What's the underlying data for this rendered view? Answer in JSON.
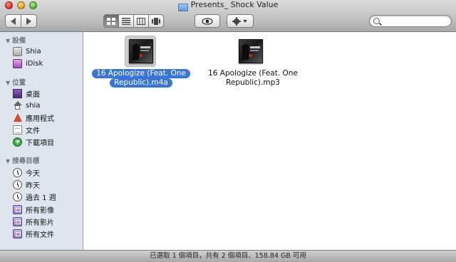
{
  "window": {
    "title": "Presents_ Shock Value",
    "folder_icon": "folder-icon"
  },
  "toolbar": {
    "back_icon": "back-arrow-icon",
    "forward_icon": "forward-arrow-icon",
    "view_icons": [
      "icon-view-icon",
      "list-view-icon",
      "column-view-icon",
      "coverflow-view-icon"
    ],
    "active_view": "icon-view",
    "quicklook_icon": "eye-icon",
    "action_icon": "gear-icon",
    "search_placeholder": ""
  },
  "sidebar": {
    "sections": [
      {
        "title": "設備",
        "items": [
          {
            "label": "Shia",
            "icon": "hard-drive-icon"
          },
          {
            "label": "iDisk",
            "icon": "idisk-icon"
          }
        ]
      },
      {
        "title": "位置",
        "items": [
          {
            "label": "桌面",
            "icon": "desktop-icon"
          },
          {
            "label": "shia",
            "icon": "home-icon"
          },
          {
            "label": "應用程式",
            "icon": "applications-icon"
          },
          {
            "label": "文件",
            "icon": "documents-icon"
          },
          {
            "label": "下載項目",
            "icon": "downloads-icon"
          }
        ]
      },
      {
        "title": "搜尋目標",
        "items": [
          {
            "label": "今天",
            "icon": "clock-icon"
          },
          {
            "label": "昨天",
            "icon": "clock-icon"
          },
          {
            "label": "過去 1 週",
            "icon": "clock-icon"
          },
          {
            "label": "所有影像",
            "icon": "smart-folder-icon"
          },
          {
            "label": "所有影片",
            "icon": "smart-folder-icon"
          },
          {
            "label": "所有文件",
            "icon": "smart-folder-icon"
          }
        ]
      }
    ]
  },
  "files": [
    {
      "name_line1": "16 Apologize (Feat. One",
      "name_line2": "Republic).m4a",
      "selected": true
    },
    {
      "name_line1": "16 Apologize (Feat. One",
      "name_line2": "Republic).mp3",
      "selected": false
    }
  ],
  "status": {
    "text": "已選取 1 個項目，共有 2 個項目、158.84 GB 可用"
  },
  "colors": {
    "selection": "#3875d7",
    "sidebar_bg": "#dfe5ec",
    "sidebar_header": "#6f7a85"
  }
}
